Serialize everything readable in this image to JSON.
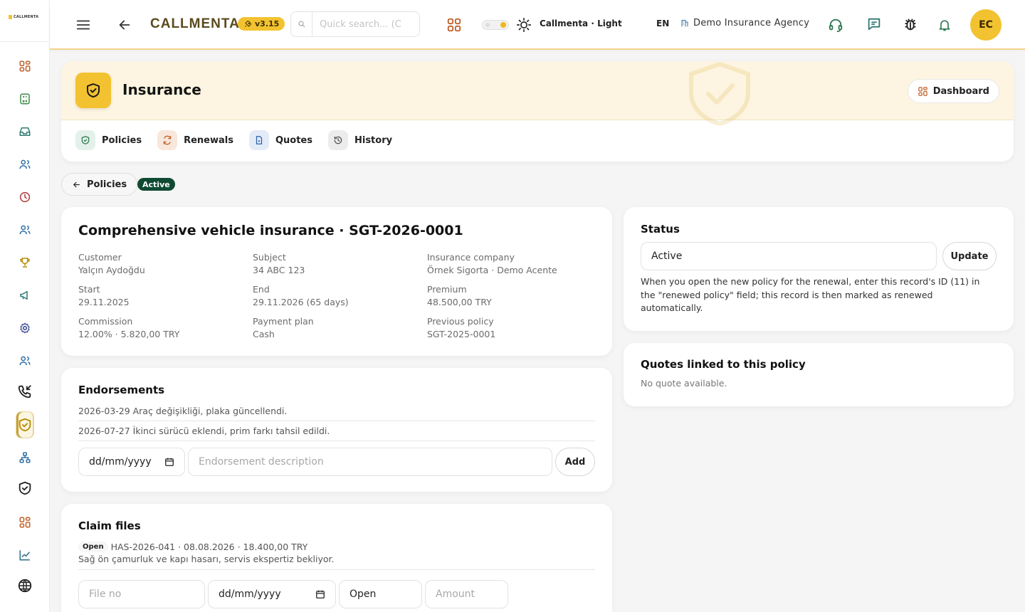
{
  "sidebar": {
    "logo_text": "CALLMENTA",
    "items": [
      {
        "icon": "grid-icon",
        "color": "#c0602a"
      },
      {
        "icon": "calculator-icon",
        "color": "#3e8a4a"
      },
      {
        "icon": "inbox-icon",
        "color": "#2f7a73"
      },
      {
        "icon": "users-icon",
        "color": "#2f6fa8"
      },
      {
        "icon": "clock-icon",
        "color": "#b03a3a"
      },
      {
        "icon": "users-icon",
        "color": "#2f6fa8"
      },
      {
        "icon": "trophy-icon",
        "color": "#b58a00"
      },
      {
        "icon": "megaphone-icon",
        "color": "#2f7a73"
      },
      {
        "icon": "settings-icon",
        "color": "#2f3f8a"
      },
      {
        "icon": "users-icon",
        "color": "#2f6fa8"
      },
      {
        "icon": "phone-incoming-icon",
        "color": "#222222"
      },
      {
        "icon": "shield-check-icon",
        "color": "#b58a00",
        "active": true
      },
      {
        "icon": "network-icon",
        "color": "#2f6fa8"
      },
      {
        "icon": "shield-check-icon",
        "color": "#222222"
      },
      {
        "icon": "grid-icon",
        "color": "#c0602a"
      },
      {
        "icon": "chart-line-icon",
        "color": "#2f6f86"
      },
      {
        "icon": "globe-icon",
        "color": "#222222"
      }
    ]
  },
  "topbar": {
    "brand": "CALLMENTA",
    "version": "v3.15",
    "search_placeholder": "Quick search... (C",
    "theme_label": "Callmenta · Light",
    "language": "EN",
    "agency": "Demo Insurance Agency",
    "avatar_initials": "EC"
  },
  "header": {
    "title": "Insurance",
    "dashboard_label": "Dashboard",
    "tabs": [
      {
        "label": "Policies",
        "icon": "shield-check-icon",
        "bg": "#e3f1ea",
        "color": "#2f7a54"
      },
      {
        "label": "Renewals",
        "icon": "refresh-icon",
        "bg": "#f8e7dc",
        "color": "#c0602a"
      },
      {
        "label": "Quotes",
        "icon": "document-icon",
        "bg": "#e3ebf8",
        "color": "#2f5fa8"
      },
      {
        "label": "History",
        "icon": "history-icon",
        "bg": "#ececec",
        "color": "#555555"
      }
    ]
  },
  "nav": {
    "back_label": "Policies",
    "status_badge": "Active"
  },
  "policy": {
    "title": "Comprehensive vehicle insurance · SGT-2026-0001",
    "fields": [
      {
        "label": "Customer",
        "value": "Yalçın Aydoğdu"
      },
      {
        "label": "Subject",
        "value": "34 ABC 123"
      },
      {
        "label": "Insurance company",
        "value": "Örnek Sigorta · Demo Acente"
      },
      {
        "label": "Start",
        "value": "29.11.2025"
      },
      {
        "label": "End",
        "value": "29.11.2026 (65 days)"
      },
      {
        "label": "Premium",
        "value": "48.500,00 TRY"
      },
      {
        "label": "Commission",
        "value": "12.00% · 5.820,00 TRY"
      },
      {
        "label": "Payment plan",
        "value": "Cash"
      },
      {
        "label": "Previous policy",
        "value": "SGT-2025-0001"
      }
    ]
  },
  "endorsements": {
    "title": "Endorsements",
    "items": [
      "2026-03-29 Araç değişikliği, plaka güncellendi.",
      "2026-07-27 İkinci sürücü eklendi, prim farkı tahsil edildi."
    ],
    "date_placeholder": "dd/mm/yyyy",
    "desc_placeholder": "Endorsement description",
    "add_label": "Add"
  },
  "claims": {
    "title": "Claim files",
    "items": [
      {
        "status": "Open",
        "summary": "HAS-2026-041 · 08.08.2026 · 18.400,00 TRY",
        "description": "Sağ ön çamurluk ve kapı hasarı, servis ekspertiz bekliyor."
      }
    ],
    "file_placeholder": "File no",
    "date_placeholder": "dd/mm/yyyy",
    "status_value": "Open",
    "amount_placeholder": "Amount"
  },
  "status_card": {
    "title": "Status",
    "value": "Active",
    "update_label": "Update",
    "note": "When you open the new policy for the renewal, enter this record's ID (11) in the \"renewed policy\" field; this record is then marked as renewed automatically."
  },
  "quotes_card": {
    "title": "Quotes linked to this policy",
    "empty": "No quote available."
  }
}
